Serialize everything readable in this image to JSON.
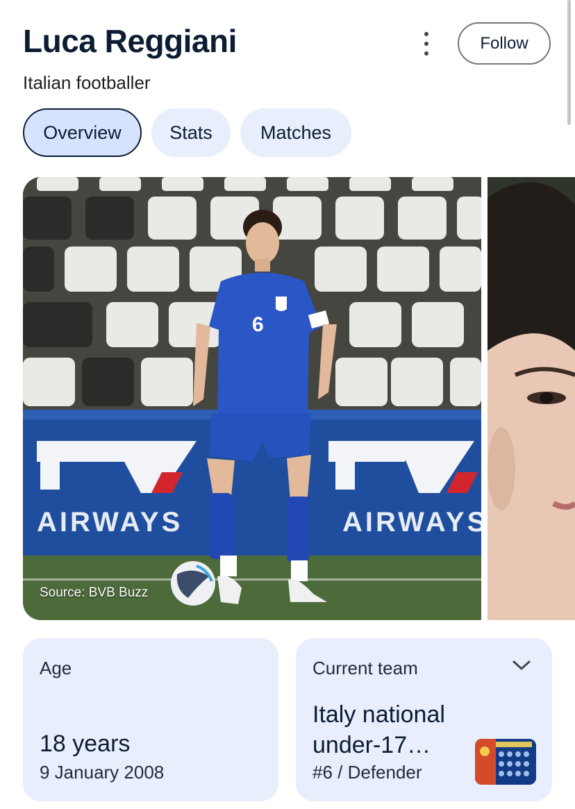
{
  "header": {
    "name": "Luca Reggiani",
    "subtitle": "Italian footballer",
    "follow_label": "Follow",
    "more_icon": "more-vert-icon"
  },
  "tabs": [
    {
      "label": "Overview",
      "active": true
    },
    {
      "label": "Stats",
      "active": false
    },
    {
      "label": "Matches",
      "active": false
    }
  ],
  "images": {
    "main_source": "Source: BVB Buzz",
    "ad_text": "AIRWAYS",
    "jersey_number": "6"
  },
  "cards": {
    "age": {
      "label": "Age",
      "value": "18 years",
      "date": "9 January 2008"
    },
    "team": {
      "label": "Current team",
      "name": "Italy national under-17…",
      "position": "#6 / Defender",
      "chevron_icon": "chevron-down-icon"
    }
  },
  "colors": {
    "accent": "#0b1c33",
    "card_bg": "#e8eefc",
    "tab_active_bg": "#d7e3fc"
  }
}
